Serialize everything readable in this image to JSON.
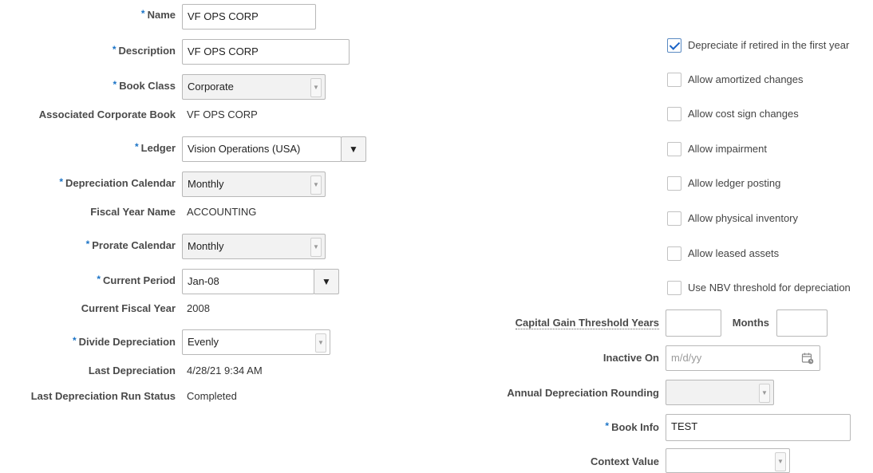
{
  "left": {
    "name": {
      "label": "Name",
      "value": "VF OPS CORP"
    },
    "description": {
      "label": "Description",
      "value": "VF OPS CORP"
    },
    "book_class": {
      "label": "Book Class",
      "value": "Corporate"
    },
    "associated_corporate_book": {
      "label": "Associated Corporate Book",
      "value": "VF OPS CORP"
    },
    "ledger": {
      "label": "Ledger",
      "value": "Vision Operations (USA)"
    },
    "depreciation_calendar": {
      "label": "Depreciation Calendar",
      "value": "Monthly"
    },
    "fiscal_year_name": {
      "label": "Fiscal Year Name",
      "value": "ACCOUNTING"
    },
    "prorate_calendar": {
      "label": "Prorate Calendar",
      "value": "Monthly"
    },
    "current_period": {
      "label": "Current Period",
      "value": "Jan-08"
    },
    "current_fiscal_year": {
      "label": "Current Fiscal Year",
      "value": "2008"
    },
    "divide_depreciation": {
      "label": "Divide Depreciation",
      "value": "Evenly"
    },
    "last_depreciation": {
      "label": "Last Depreciation",
      "value": "4/28/21 9:34 AM"
    },
    "last_depreciation_run_status": {
      "label": "Last Depreciation Run Status",
      "value": "Completed"
    }
  },
  "right": {
    "checkboxes": [
      {
        "label": "Depreciate if retired in the first year",
        "checked": true
      },
      {
        "label": "Allow amortized changes",
        "checked": false
      },
      {
        "label": "Allow cost sign changes",
        "checked": false
      },
      {
        "label": "Allow impairment",
        "checked": false
      },
      {
        "label": "Allow ledger posting",
        "checked": false
      },
      {
        "label": "Allow physical inventory",
        "checked": false
      },
      {
        "label": "Allow leased assets",
        "checked": false
      },
      {
        "label": "Use NBV threshold for depreciation",
        "checked": false
      }
    ],
    "capital_gain_threshold_years": {
      "label": "Capital Gain Threshold Years",
      "value": ""
    },
    "months": {
      "label": "Months",
      "value": ""
    },
    "inactive_on": {
      "label": "Inactive On",
      "placeholder": "m/d/yy"
    },
    "annual_depreciation_rounding": {
      "label": "Annual Depreciation Rounding",
      "value": ""
    },
    "book_info": {
      "label": "Book Info",
      "value": "TEST"
    },
    "context_value": {
      "label": "Context Value",
      "value": ""
    }
  },
  "required_marker": "*",
  "icons": {
    "dropdown": "caret-down-icon",
    "select": "chevron-down-icon",
    "calendar": "calendar-icon",
    "check": "checkmark-icon"
  },
  "colors": {
    "required": "#1a73c6",
    "check": "#1a63c6",
    "border": "#b8b8b8",
    "label": "#4a4a4a"
  }
}
